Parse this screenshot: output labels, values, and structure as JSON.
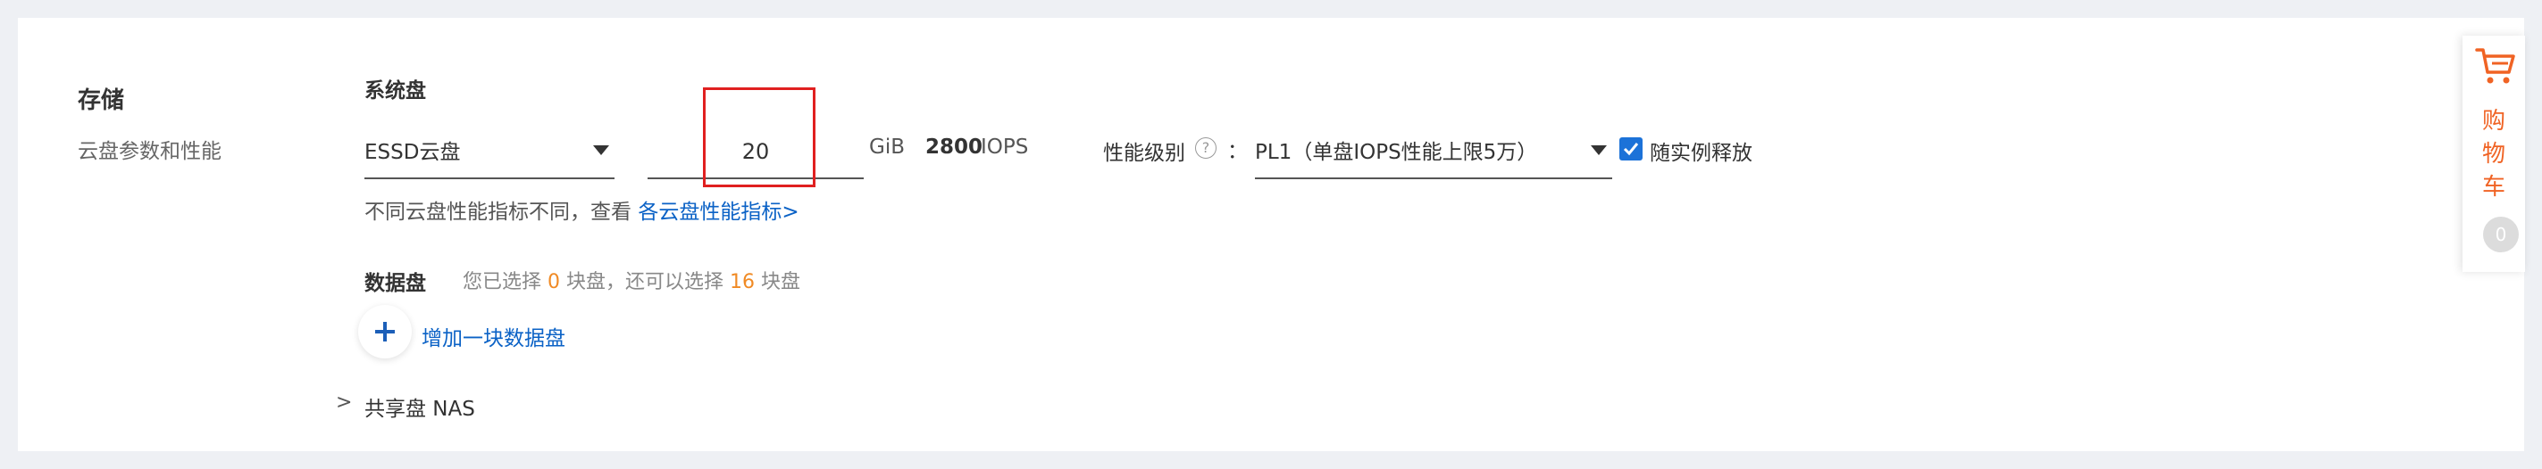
{
  "storage": {
    "title": "存储",
    "subtitle": "云盘参数和性能"
  },
  "system_disk": {
    "title": "系统盘",
    "type_selected": "ESSD云盘",
    "size_value": "20",
    "size_unit": "GiB",
    "iops_value": "2800",
    "iops_unit": "IOPS",
    "perf_label": "性能级别",
    "perf_colon": "：",
    "perf_selected": "PL1（单盘IOPS性能上限5万）",
    "release_label": "随实例释放",
    "release_checked": true,
    "hint_text": "不同云盘性能指标不同，查看 ",
    "hint_link": "各云盘性能指标>"
  },
  "data_disk": {
    "title": "数据盘",
    "info_prefix": "您已选择 ",
    "selected_count": "0",
    "info_middle": " 块盘，还可以选择 ",
    "remaining_count": "16",
    "info_suffix": " 块盘",
    "add_label": "增加一块数据盘"
  },
  "shared_disk": {
    "chevron": ">",
    "label": "共享盘 NAS"
  },
  "cart": {
    "chars": [
      "购",
      "物",
      "车"
    ],
    "count": "0"
  },
  "icons": {
    "help": "question-circle-icon",
    "cart": "shopping-cart-icon",
    "add": "plus-icon",
    "dropdown": "caret-down-icon",
    "check": "check-icon"
  },
  "colors": {
    "accent_blue": "#1c72d8",
    "link_blue": "#0b62c6",
    "orange": "#f08a24",
    "cart_orange": "#f06324",
    "highlight_red": "#e02020"
  }
}
